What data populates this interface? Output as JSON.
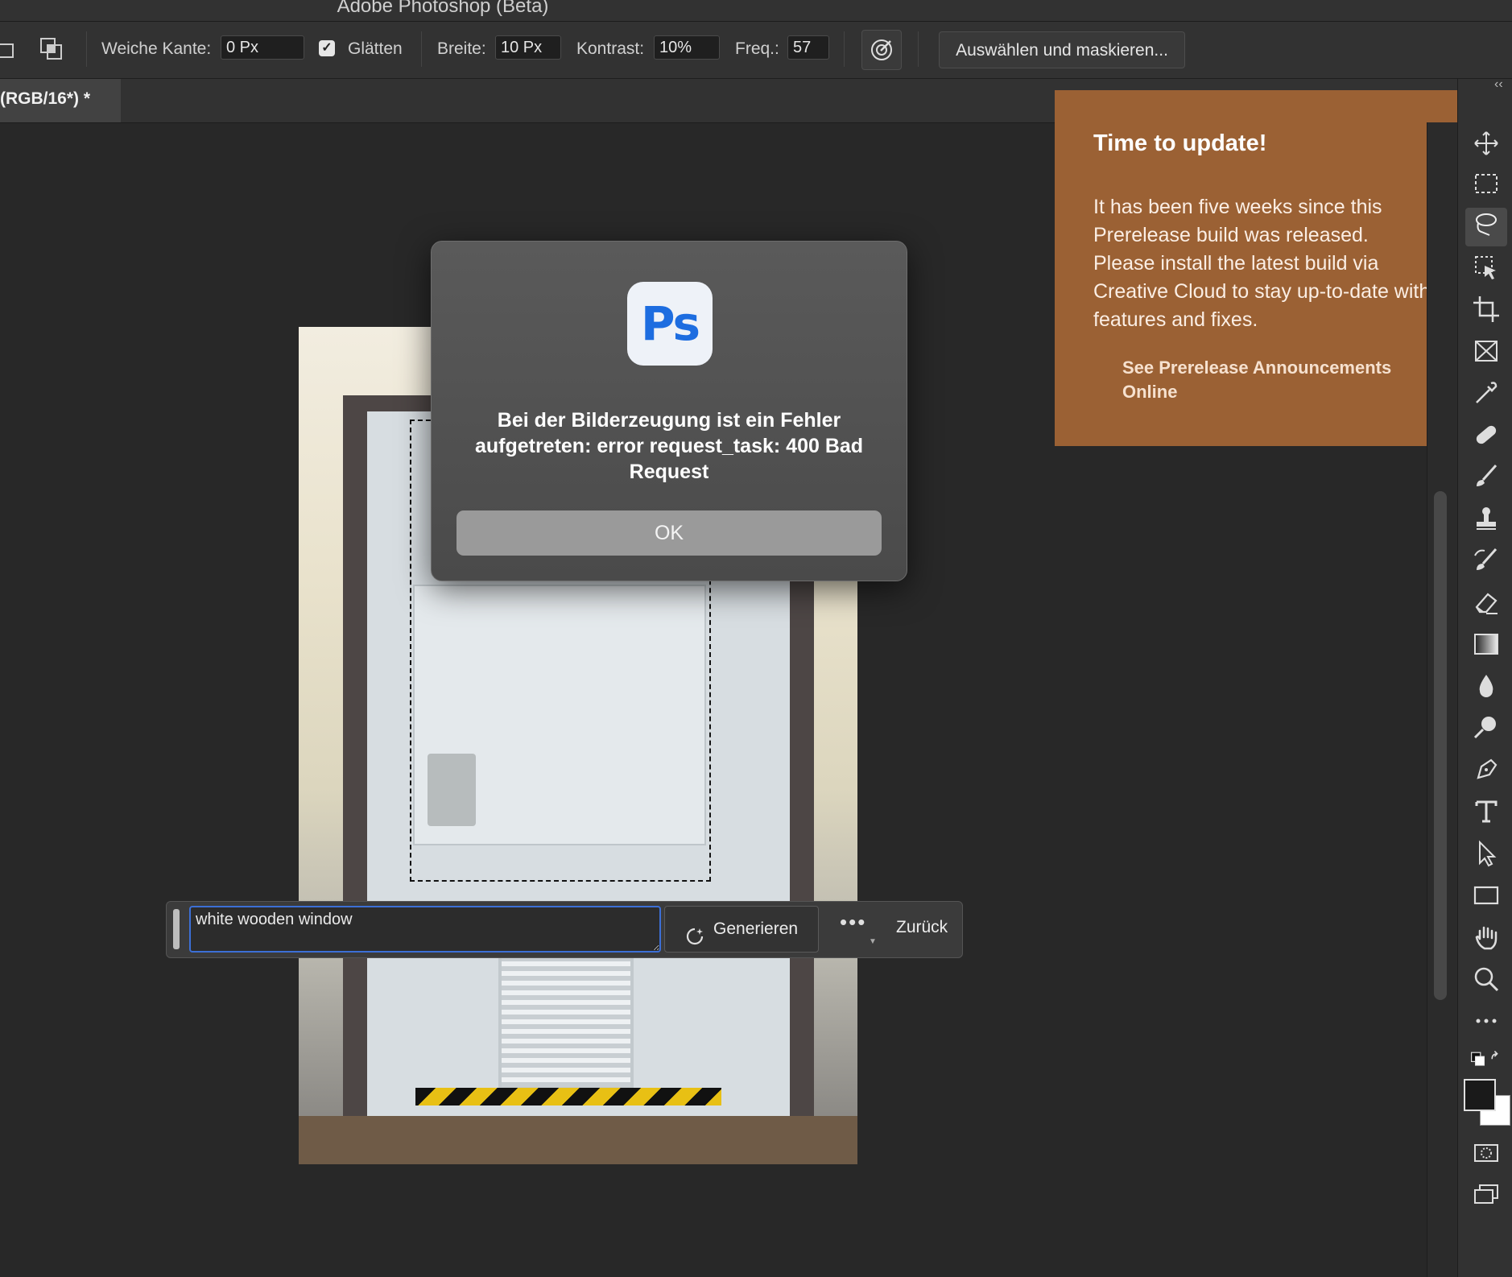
{
  "window": {
    "title": "Adobe Photoshop (Beta)"
  },
  "options_bar": {
    "feather_label": "Weiche Kante:",
    "feather_value": "0 Px",
    "antialias_label": "Glätten",
    "antialias_checked": true,
    "width_label": "Breite:",
    "width_value": "10 Px",
    "contrast_label": "Kontrast:",
    "contrast_value": "10%",
    "frequency_label": "Freq.:",
    "frequency_value": "57",
    "select_mask_label": "Auswählen und maskieren..."
  },
  "document_tab": {
    "label": "(RGB/16*) *"
  },
  "dialog": {
    "icon_text": "Ps",
    "message": "Bei der Bilderzeugung ist ein Fehler aufgetreten: error request_task: 400 Bad Request",
    "ok_label": "OK"
  },
  "update_banner": {
    "title": "Time to update!",
    "body": "It has been five weeks since this Prerelease build was released. Please install the latest build via Creative Cloud to stay up-to-date with features and fixes.",
    "link": "See Prerelease Announcements Online",
    "color": "#9b6134"
  },
  "generative_bar": {
    "prompt_value": "white wooden window",
    "generate_label": "Generieren",
    "more_label": "•••",
    "back_label": "Zurück"
  },
  "toolbar": {
    "collapse_label": "‹‹",
    "tools": [
      "move-icon",
      "marquee-icon",
      "lasso-icon",
      "object-select-icon",
      "crop-icon",
      "frame-icon",
      "eyedropper-icon",
      "healing-icon",
      "brush-icon",
      "stamp-icon",
      "history-brush-icon",
      "eraser-icon",
      "gradient-icon",
      "blur-icon",
      "dodge-icon",
      "pen-icon",
      "type-icon",
      "path-select-icon",
      "rectangle-icon",
      "hand-icon",
      "zoom-icon",
      "more-tools-icon"
    ],
    "foreground_color": "#1a1a1a",
    "background_color": "#ffffff"
  }
}
